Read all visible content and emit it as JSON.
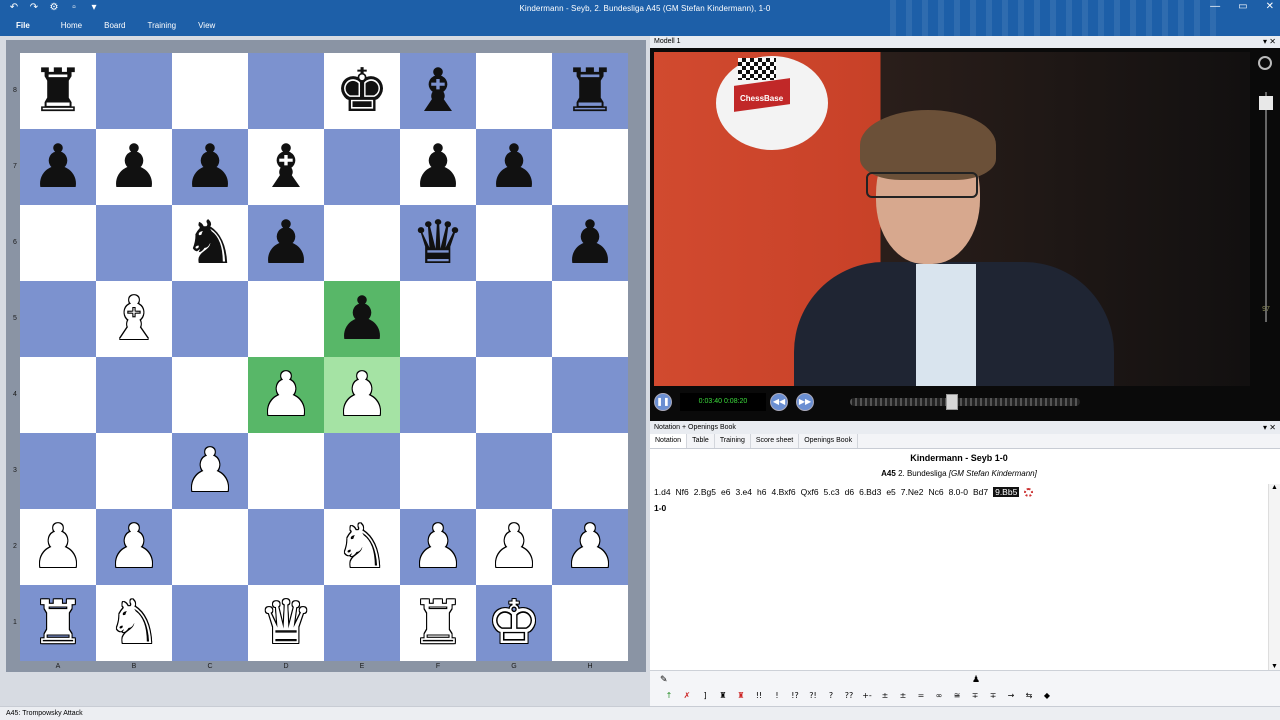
{
  "window": {
    "title": "Kindermann - Seyb, 2. Bundesliga  A45  (GM Stefan Kindermann), 1-0",
    "controls": [
      "—",
      "▭",
      "✕"
    ]
  },
  "ribbon": {
    "tabs": [
      "File",
      "Home",
      "Board",
      "Training",
      "View"
    ]
  },
  "board": {
    "files": [
      "A",
      "B",
      "C",
      "D",
      "E",
      "F",
      "G",
      "H"
    ],
    "ranks": [
      "8",
      "7",
      "6",
      "5",
      "4",
      "3",
      "2",
      "1"
    ],
    "highlighted": [
      "e5",
      "d4",
      "e4"
    ],
    "pieces": {
      "a8": "r",
      "e8": "k",
      "f8": "b",
      "h8": "r",
      "a7": "p",
      "b7": "p",
      "c7": "p",
      "d7": "b",
      "f7": "p",
      "g7": "p",
      "c6": "n",
      "d6": "p",
      "f6": "q",
      "h6": "p",
      "b5": "B",
      "e5": "p",
      "d4": "P",
      "e4": "P",
      "c3": "P",
      "a2": "P",
      "b2": "P",
      "e2": "N",
      "f2": "P",
      "g2": "P",
      "h2": "P",
      "a1": "R",
      "b1": "N",
      "d1": "Q",
      "f1": "R",
      "g1": "K"
    }
  },
  "video": {
    "panel_title": "Modell 1",
    "time": "0:03:40 0:08:20",
    "logo_text": "ChessBase",
    "side_value": "97",
    "progress_fraction": 0.44
  },
  "notation": {
    "panel_title": "Notation + Openings Book",
    "tabs": [
      "Notation",
      "Table",
      "Training",
      "Score sheet",
      "Openings Book"
    ],
    "active_tab": 0,
    "game_title": "Kindermann - Seyb  1-0",
    "eco": "A45",
    "event": "2. Bundesliga",
    "annotator": "[GM Stefan Kindermann]",
    "moves": [
      "1.d4",
      "Nf6",
      "2.Bg5",
      "e6",
      "3.e4",
      "h6",
      "4.Bxf6",
      "Qxf6",
      "5.c3",
      "d6",
      "6.Bd3",
      "e5",
      "7.Ne2",
      "Nc6",
      "8.0-0",
      "Bd7",
      "9.Bb5"
    ],
    "current_move": 16,
    "result": "1-0"
  },
  "annotation_bar": {
    "symbols": [
      "↑",
      "✗",
      "]",
      "♜",
      "♜",
      "!!",
      "!",
      "!?",
      "?!",
      "?",
      "??",
      "+-",
      "±",
      "±",
      "=",
      "∞",
      "≅",
      "∓",
      "∓",
      "→",
      "⇆",
      "◆"
    ]
  },
  "status": {
    "text": "A45: Trompowsky Attack"
  }
}
